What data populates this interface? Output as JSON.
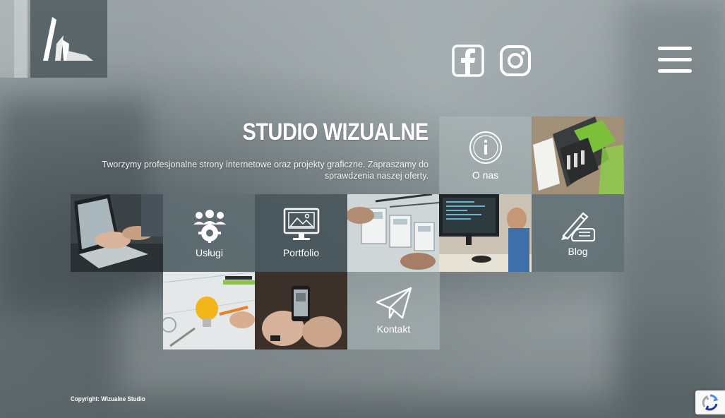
{
  "header": {
    "logo_icon": "wizualne-logo",
    "social": [
      {
        "name": "facebook-icon"
      },
      {
        "name": "instagram-icon"
      }
    ],
    "menu_icon": "hamburger-icon"
  },
  "hero": {
    "title": "STUDIO WIZUALNE",
    "intro": "Tworzymy profesjonalne strony internetowe oraz projekty graficzne. Zapraszamy do sprawdzenia naszej oferty."
  },
  "tiles": {
    "about": {
      "label": "O nas",
      "icon": "info-icon"
    },
    "services": {
      "label": "Usługi",
      "icon": "team-gear-icon"
    },
    "portfolio": {
      "label": "Portfolio",
      "icon": "monitor-image-icon"
    },
    "blog": {
      "label": "Blog",
      "icon": "hand-pen-icon"
    },
    "contact": {
      "label": "Kontakt",
      "icon": "paper-plane-icon"
    }
  },
  "footer": {
    "copyright": "Copyright: Wizualne Studio"
  },
  "colors": {
    "tile_overlay": "#5f6e73",
    "text": "#ffffff",
    "accent_green": "#7bbf3a"
  }
}
